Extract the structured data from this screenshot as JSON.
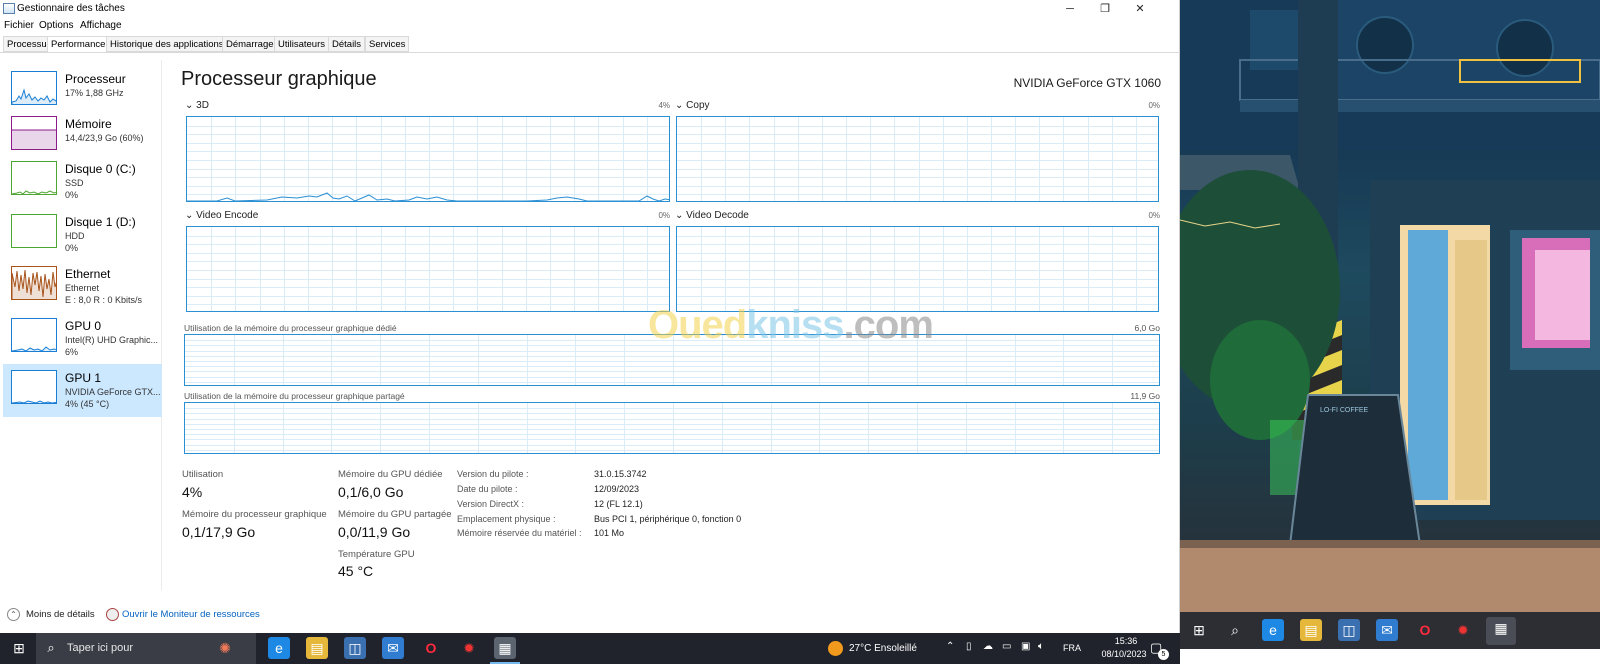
{
  "window": {
    "title": "Gestionnaire des tâches",
    "controls": {
      "minimize": "─",
      "maximize": "❐",
      "close": "✕"
    }
  },
  "menu": [
    "Fichier",
    "Options",
    "Affichage"
  ],
  "tabs": [
    "Processus",
    "Performance",
    "Historique des applications",
    "Démarrage",
    "Utilisateurs",
    "Détails",
    "Services"
  ],
  "active_tab": "Performance",
  "sidebar": [
    {
      "name": "Processeur",
      "lines": [
        "17%  1,88 GHz"
      ],
      "color": "#1a7fd4"
    },
    {
      "name": "Mémoire",
      "lines": [
        "14,4/23,9 Go (60%)"
      ],
      "color": "#8b1a8b"
    },
    {
      "name": "Disque 0 (C:)",
      "lines": [
        "SSD",
        "0%"
      ],
      "color": "#4da532"
    },
    {
      "name": "Disque 1 (D:)",
      "lines": [
        "HDD",
        "0%"
      ],
      "color": "#4da532"
    },
    {
      "name": "Ethernet",
      "lines": [
        "Ethernet",
        "E : 8,0  R : 0 Kbits/s"
      ],
      "color": "#a7531a"
    },
    {
      "name": "GPU 0",
      "lines": [
        "Intel(R) UHD Graphic...",
        "6%"
      ],
      "color": "#1a7fd4"
    },
    {
      "name": "GPU 1",
      "lines": [
        "NVIDIA GeForce GTX...",
        "4% (45 °C)"
      ],
      "color": "#1a7fd4"
    }
  ],
  "main": {
    "title": "Processeur graphique",
    "gpu_name": "NVIDIA GeForce GTX 1060",
    "graphs": [
      {
        "label": "3D",
        "pct": "4%"
      },
      {
        "label": "Copy",
        "pct": "0%"
      },
      {
        "label": "Video Encode",
        "pct": "0%"
      },
      {
        "label": "Video Decode",
        "pct": "0%"
      }
    ],
    "mem_graphs": [
      {
        "label": "Utilisation de la mémoire du processeur graphique dédié",
        "max": "6,0 Go"
      },
      {
        "label": "Utilisation de la mémoire du processeur graphique partagé",
        "max": "11,9 Go"
      }
    ],
    "stats": {
      "utilisation_label": "Utilisation",
      "utilisation": "4%",
      "gpu_mem_label": "Mémoire du processeur graphique",
      "gpu_mem": "0,1/17,9 Go",
      "dedicated_label": "Mémoire du GPU dédiée",
      "dedicated": "0,1/6,0 Go",
      "shared_label": "Mémoire du GPU partagée",
      "shared": "0,0/11,9 Go",
      "temp_label": "Température GPU",
      "temp": "45 °C"
    },
    "details": [
      {
        "k": "Version du pilote :",
        "v": "31.0.15.3742"
      },
      {
        "k": "Date du pilote :",
        "v": "12/09/2023"
      },
      {
        "k": "Version DirectX :",
        "v": "12 (FL 12.1)"
      },
      {
        "k": "Emplacement physique :",
        "v": "Bus PCI 1, périphérique 0, fonction 0"
      },
      {
        "k": "Mémoire réservée du matériel :",
        "v": "101 Mo"
      }
    ]
  },
  "footer": {
    "less": "Moins de détails",
    "resmon": "Ouvrir le Moniteur de ressources"
  },
  "watermark": {
    "p1": "Oued",
    "p2": "kniss",
    "p3": ".com"
  },
  "taskbar": {
    "search_placeholder": "Taper ici pour",
    "weather": "27°C  Ensoleillé",
    "lang": "FRA",
    "time": "15:36",
    "date": "08/10/2023",
    "notif_count": "5"
  },
  "wallpaper": {
    "sign": "LO-FI COFFEE"
  }
}
